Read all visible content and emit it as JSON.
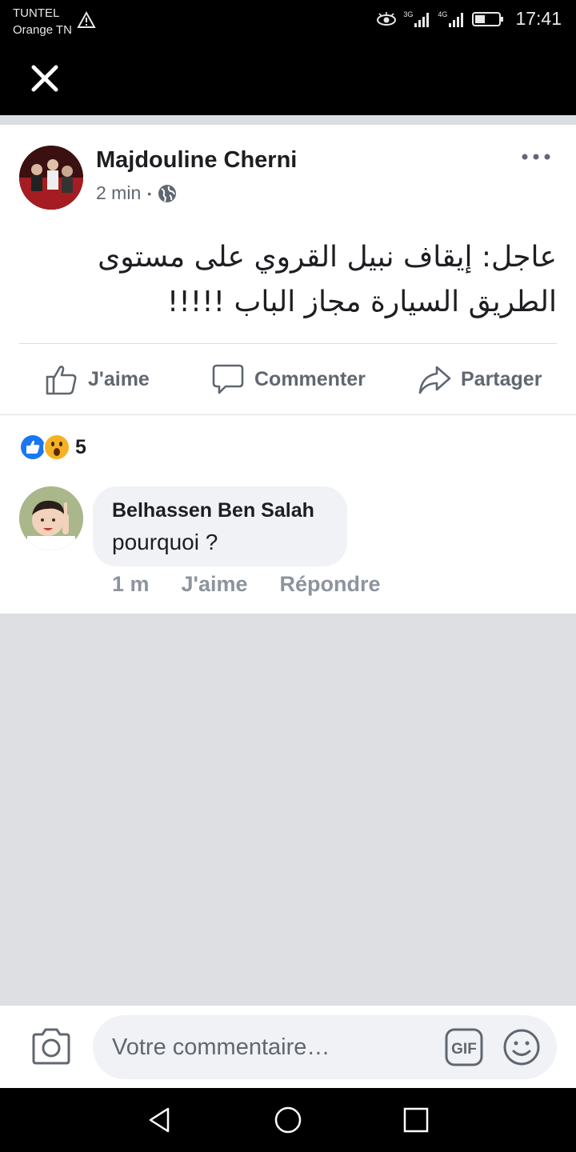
{
  "status_bar": {
    "carrier_line1": "TUNTEL",
    "carrier_line2": "Orange TN",
    "net1": "3G",
    "net2": "4G",
    "time": "17:41"
  },
  "post": {
    "author": "Majdouline Cherni",
    "time": "2 min",
    "separator": "•",
    "privacy_icon": "globe-icon",
    "text": "عاجل: إيقاف نبيل القروي على مستوى الطريق السيارة مجاز الباب !!!!!",
    "actions": {
      "like": "J'aime",
      "comment": "Commenter",
      "share": "Partager"
    }
  },
  "reactions": {
    "types": [
      "like",
      "wow"
    ],
    "count": "5"
  },
  "comment": {
    "author": "Belhassen Ben Salah",
    "text": "pourquoi ?",
    "time": "1 m",
    "like": "J'aime",
    "reply": "Répondre"
  },
  "composer": {
    "placeholder": "Votre commentaire…",
    "gif_label": "GIF"
  },
  "colors": {
    "brand_blue": "#1877f2",
    "text_primary": "#1c1e21",
    "text_secondary": "#606770",
    "reaction_wow": "#f7b125"
  }
}
